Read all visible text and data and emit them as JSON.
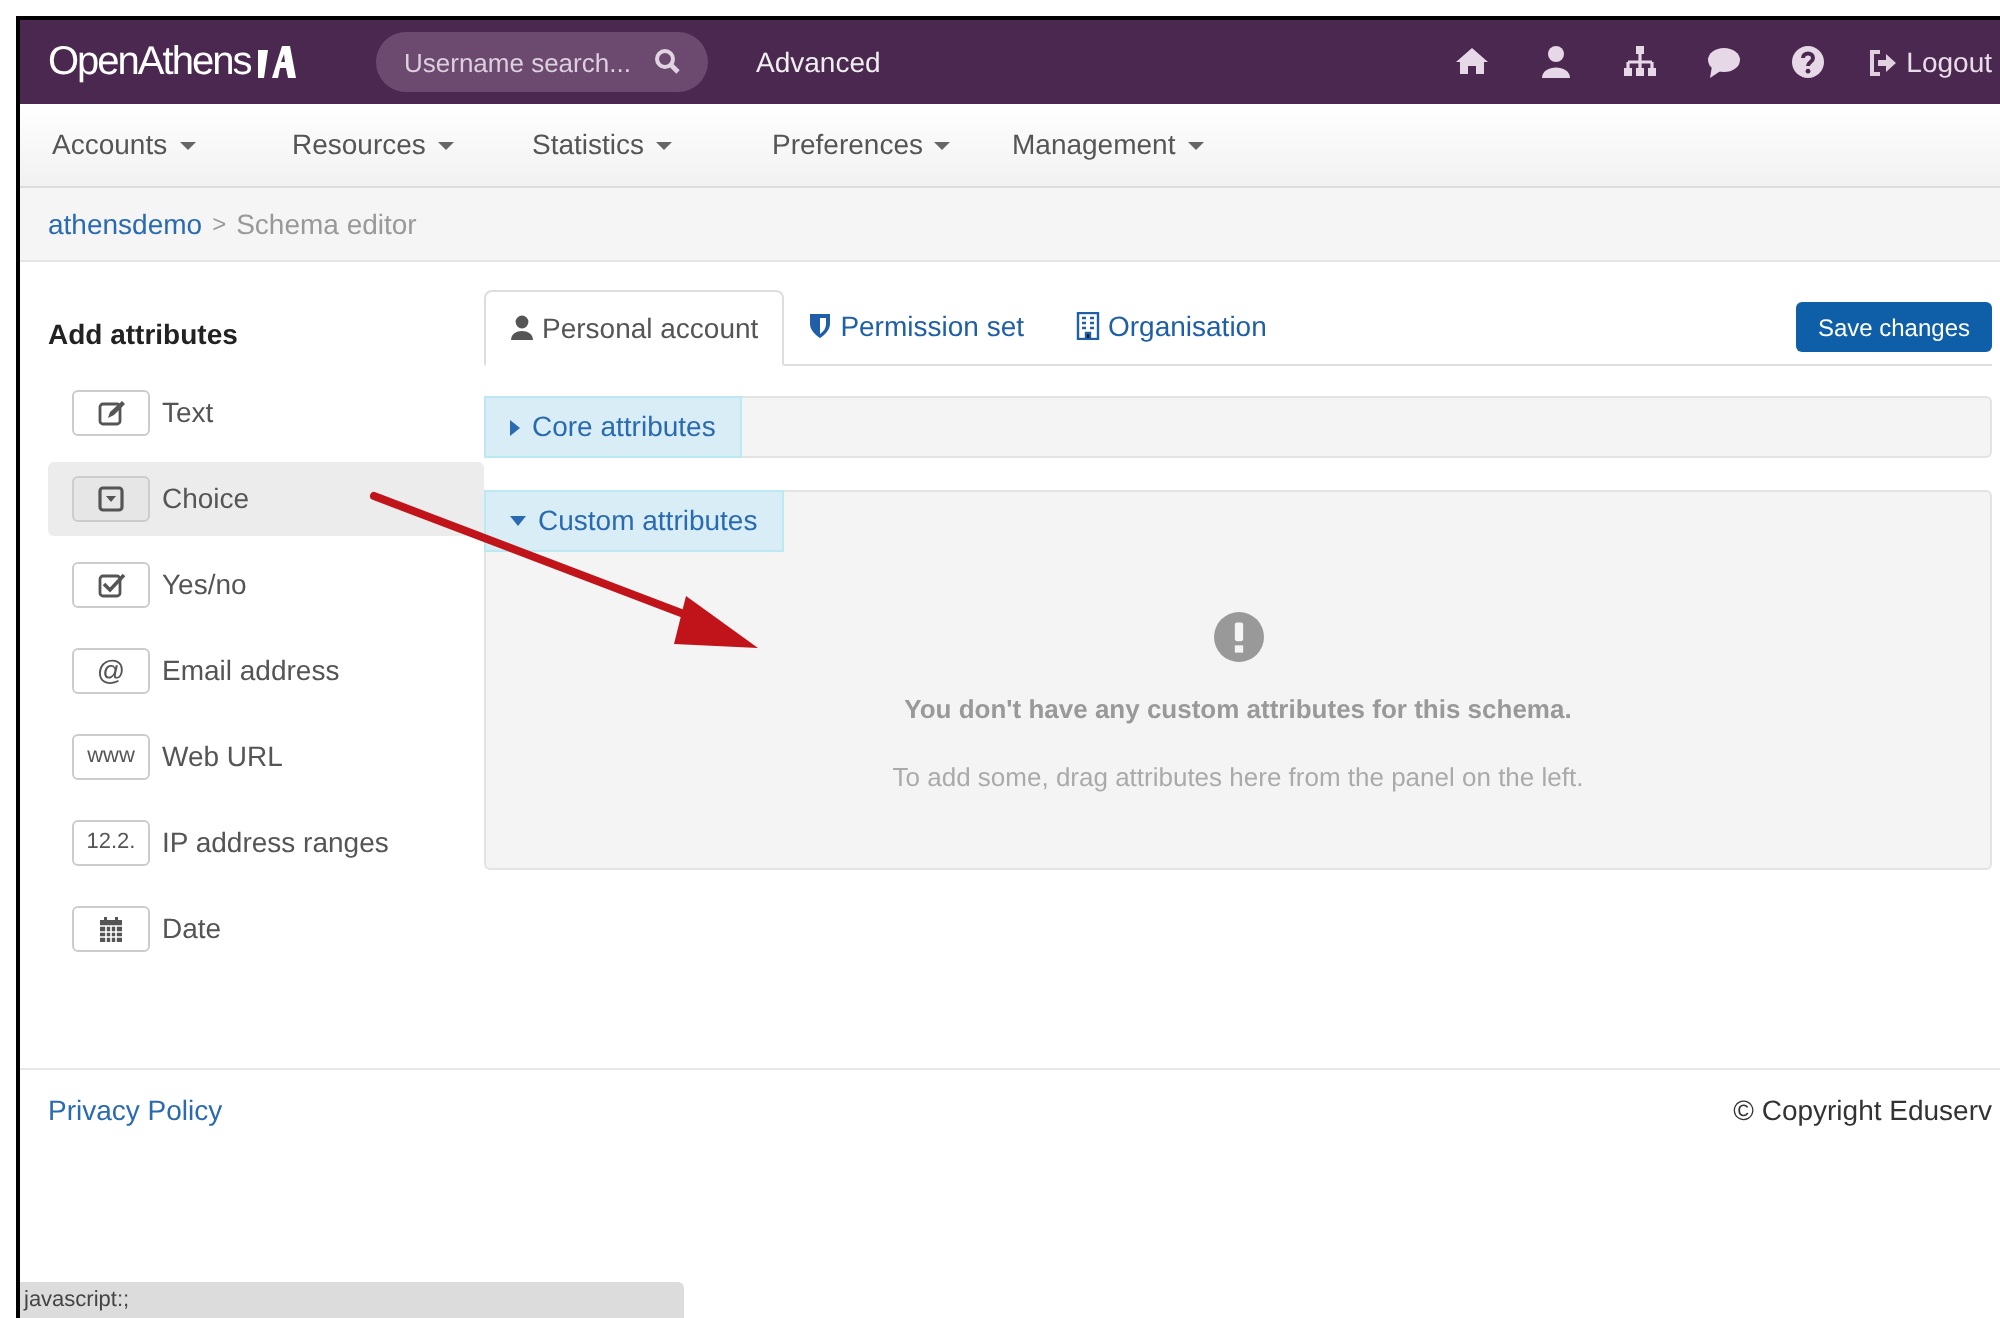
{
  "header": {
    "logo": "OpenAthens",
    "search": {
      "placeholder": "Username search..."
    },
    "advanced": "Advanced",
    "icons": [
      {
        "kind": "home"
      },
      {
        "kind": "user"
      },
      {
        "kind": "org"
      },
      {
        "kind": "chat"
      },
      {
        "kind": "help"
      }
    ],
    "logout": "Logout"
  },
  "menu": [
    "Accounts",
    "Resources",
    "Statistics",
    "Preferences",
    "Management"
  ],
  "breadcrumb": {
    "link": "athensdemo",
    "separator": ">",
    "current": "Schema editor"
  },
  "sidebar": {
    "title": "Add attributes",
    "items": [
      {
        "kind": "text",
        "label": "Text",
        "selected": false
      },
      {
        "kind": "choice",
        "label": "Choice",
        "selected": true
      },
      {
        "kind": "yesno",
        "label": "Yes/no",
        "selected": false
      },
      {
        "kind": "email",
        "badge": "@",
        "label": "Email address",
        "selected": false
      },
      {
        "kind": "url",
        "badge": "www",
        "label": "Web URL",
        "selected": false
      },
      {
        "kind": "ip",
        "badge": "12.2.",
        "label": "IP address ranges",
        "selected": false
      },
      {
        "kind": "date",
        "label": "Date",
        "selected": false
      }
    ]
  },
  "tabs": [
    {
      "kind": "user",
      "label": "Personal account",
      "selected": true
    },
    {
      "kind": "shield",
      "label": "Permission set",
      "selected": false
    },
    {
      "kind": "building",
      "label": "Organisation",
      "selected": false
    }
  ],
  "save_button": "Save changes",
  "panels": [
    {
      "label": "Core attributes",
      "expanded": false
    },
    {
      "label": "Custom attributes",
      "expanded": true,
      "message": "You don't have any custom attributes for this schema.",
      "hint": "To add some, drag attributes here from the panel on the left."
    }
  ],
  "footer": {
    "privacy": "Privacy Policy",
    "copyright": "© Copyright Eduserv"
  },
  "status_bar": "javascript:;"
}
